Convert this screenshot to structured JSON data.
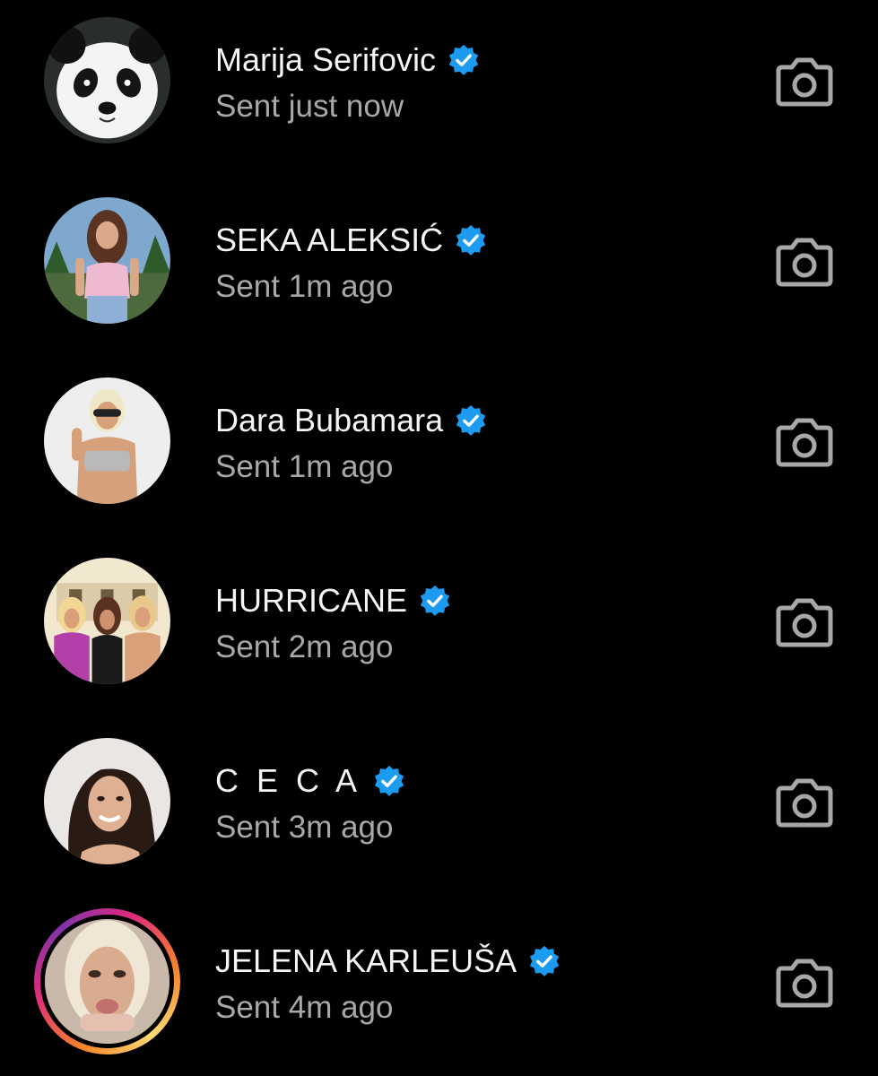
{
  "conversations": [
    {
      "name": "Marija Serifovic",
      "verified": true,
      "status": "Sent just now",
      "avatar": "panda-avatar",
      "story_ring": false
    },
    {
      "name": "SEKA ALEKSIĆ",
      "verified": true,
      "status": "Sent 1m ago",
      "avatar": "user-photo-avatar",
      "story_ring": false
    },
    {
      "name": "Dara Bubamara",
      "verified": true,
      "status": "Sent 1m ago",
      "avatar": "user-photo-avatar",
      "story_ring": false
    },
    {
      "name": "HURRICANE",
      "verified": true,
      "status": "Sent 2m ago",
      "avatar": "group-photo-avatar",
      "story_ring": false
    },
    {
      "name": "C E C A",
      "verified": true,
      "status": "Sent 3m ago",
      "avatar": "user-photo-avatar",
      "story_ring": false
    },
    {
      "name": "JELENA KARLEUŠA",
      "verified": true,
      "status": "Sent 4m ago",
      "avatar": "user-photo-avatar",
      "story_ring": true
    }
  ],
  "icons": {
    "verified": "verified-badge-icon",
    "camera": "camera-icon"
  },
  "colors": {
    "background": "#000000",
    "name_text": "#f5f5f5",
    "status_text": "#a8a8a8",
    "verified_badge": "#1d9bf0",
    "camera_icon": "#a8a8a8"
  }
}
